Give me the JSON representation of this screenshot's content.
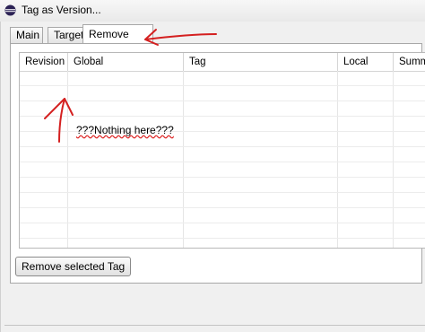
{
  "window": {
    "title": "Tag as Version..."
  },
  "tabs": [
    {
      "label": "Main",
      "active": false
    },
    {
      "label": "Target",
      "active": false
    },
    {
      "label": "Remove Tag",
      "active": true
    }
  ],
  "table": {
    "columns": [
      "Revision",
      "Global",
      "Tag",
      "Local",
      "Summ"
    ],
    "rows": []
  },
  "annotation": {
    "text": "???Nothing here???",
    "color": "#d42020"
  },
  "actions": {
    "remove_selected": "Remove selected Tag"
  }
}
